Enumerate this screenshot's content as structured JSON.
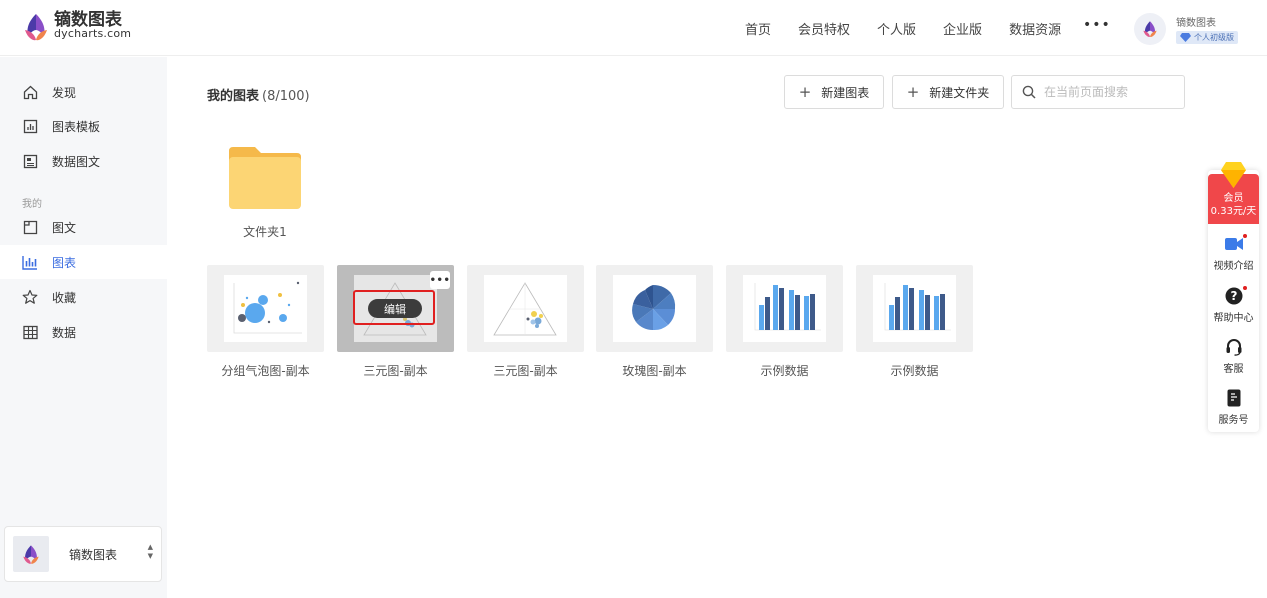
{
  "brand": {
    "name_cn": "镝数图表",
    "name_en": "dycharts.com"
  },
  "nav": {
    "items": [
      "首页",
      "会员特权",
      "个人版",
      "企业版",
      "数据资源"
    ],
    "more": "•••"
  },
  "user": {
    "name": "镝数图表",
    "badge": "个人初级版"
  },
  "sidebar": {
    "items": [
      {
        "label": "发现",
        "icon": "home-icon"
      },
      {
        "label": "图表模板",
        "icon": "chart-template-icon"
      },
      {
        "label": "数据图文",
        "icon": "data-article-icon"
      }
    ],
    "section_label": "我的",
    "my_items": [
      {
        "label": "图文",
        "icon": "article-icon"
      },
      {
        "label": "图表",
        "icon": "bar-chart-icon",
        "active": true
      },
      {
        "label": "收藏",
        "icon": "star-icon"
      },
      {
        "label": "数据",
        "icon": "table-icon"
      }
    ],
    "team": {
      "name": "镝数图表"
    }
  },
  "main": {
    "title": "我的图表",
    "count": "(8/100)",
    "new_chart_label": "新建图表",
    "new_folder_label": "新建文件夹",
    "search_placeholder": "在当前页面搜索",
    "folder": {
      "name": "文件夹1"
    },
    "charts": [
      {
        "name": "分组气泡图-副本",
        "thumb": "bubble"
      },
      {
        "name": "三元图-副本",
        "thumb": "ternary",
        "hover": true,
        "edit_label": "编辑"
      },
      {
        "name": "三元图-副本",
        "thumb": "ternary"
      },
      {
        "name": "玫瑰图-副本",
        "thumb": "rose"
      },
      {
        "name": "示例数据",
        "thumb": "bar"
      },
      {
        "name": "示例数据",
        "thumb": "bar"
      }
    ]
  },
  "float_bar": {
    "vip": {
      "label": "会员",
      "price": "0.33元/天"
    },
    "items": [
      {
        "label": "视频介绍",
        "icon": "video-icon"
      },
      {
        "label": "帮助中心",
        "icon": "help-icon"
      },
      {
        "label": "客服",
        "icon": "headset-icon"
      },
      {
        "label": "服务号",
        "icon": "service-account-icon"
      }
    ]
  },
  "colors": {
    "accent": "#3b6de0",
    "vip_red": "#f0474a",
    "folder": "#fcd574",
    "edit_outline": "#e02020"
  }
}
